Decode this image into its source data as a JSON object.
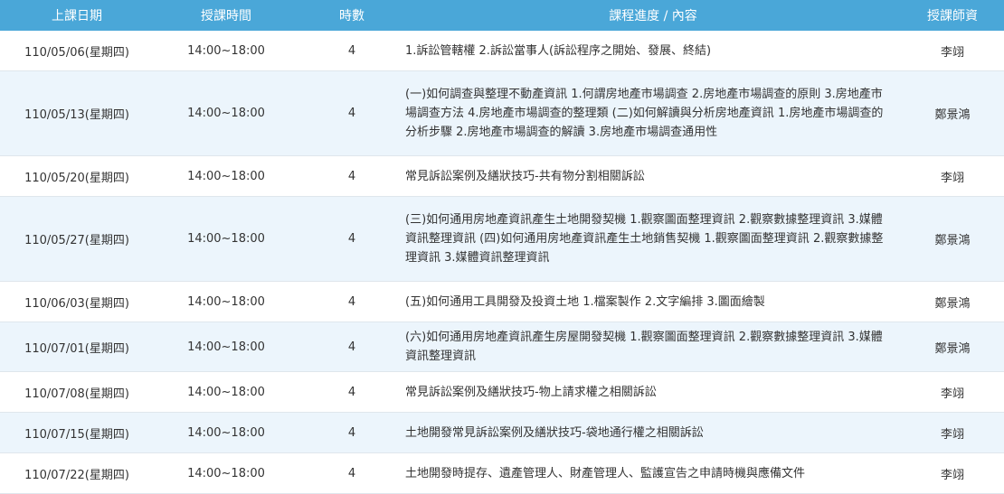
{
  "headers": {
    "date": "上課日期",
    "time": "授課時間",
    "hours": "時數",
    "content": "課程進度 / 內容",
    "teacher": "授課師資"
  },
  "rows": [
    {
      "date": "110/05/06(星期四)",
      "time": "14:00~18:00",
      "hours": "4",
      "content": "1.訴訟管轄權 2.訴訟當事人(訴訟程序之開始、發展、終結)",
      "teacher": "李翊"
    },
    {
      "date": "110/05/13(星期四)",
      "time": "14:00~18:00",
      "hours": "4",
      "content": "(一)如何調查與整理不動產資訊 1.何謂房地產市場調查 2.房地產市場調查的原則 3.房地產市場調查方法 4.房地產市場調查的整理類 (二)如何解讀與分析房地產資訊 1.房地產市場調查的分析步驟 2.房地產市場調查的解讀 3.房地產市場調查通用性",
      "teacher": "鄭景鴻"
    },
    {
      "date": "110/05/20(星期四)",
      "time": "14:00~18:00",
      "hours": "4",
      "content": "常見訴訟案例及繕狀技巧-共有物分割相關訴訟",
      "teacher": "李翊"
    },
    {
      "date": "110/05/27(星期四)",
      "time": "14:00~18:00",
      "hours": "4",
      "content": "(三)如何通用房地產資訊產生土地開發契機 1.觀察圖面整理資訊 2.觀察數據整理資訊 3.媒體資訊整理資訊 (四)如何通用房地產資訊產生土地銷售契機 1.觀察圖面整理資訊 2.觀察數據整理資訊 3.媒體資訊整理資訊",
      "teacher": "鄭景鴻"
    },
    {
      "date": "110/06/03(星期四)",
      "time": "14:00~18:00",
      "hours": "4",
      "content": "(五)如何通用工具開發及投資土地 1.檔案製作 2.文字編排 3.圖面繪製",
      "teacher": "鄭景鴻"
    },
    {
      "date": "110/07/01(星期四)",
      "time": "14:00~18:00",
      "hours": "4",
      "content": "(六)如何通用房地產資訊產生房屋開發契機 1.觀察圖面整理資訊 2.觀察數據整理資訊 3.媒體資訊整理資訊",
      "teacher": "鄭景鴻"
    },
    {
      "date": "110/07/08(星期四)",
      "time": "14:00~18:00",
      "hours": "4",
      "content": "常見訴訟案例及繕狀技巧-物上請求權之相關訴訟",
      "teacher": "李翊"
    },
    {
      "date": "110/07/15(星期四)",
      "time": "14:00~18:00",
      "hours": "4",
      "content": "土地開發常見訴訟案例及繕狀技巧-袋地通行權之相關訴訟",
      "teacher": "李翊"
    },
    {
      "date": "110/07/22(星期四)",
      "time": "14:00~18:00",
      "hours": "4",
      "content": "土地開發時提存、遺產管理人、財產管理人、監護宣告之申請時機與應備文件",
      "teacher": "李翊"
    }
  ]
}
